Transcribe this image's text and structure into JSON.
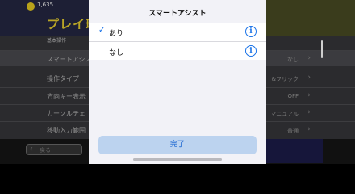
{
  "background": {
    "coins": "1,635",
    "title": "プレイ環",
    "section": "基本操作",
    "rows": [
      {
        "label": "スマートアシス",
        "value": "なし"
      },
      {
        "label": "操作タイプ",
        "value": "&フリック"
      },
      {
        "label": "方向キー表示",
        "value": "OFF"
      },
      {
        "label": "カーソルチェ",
        "value": "マニュアル"
      },
      {
        "label": "移動入力範囲",
        "value": "普通"
      }
    ],
    "back_label": "戻る"
  },
  "sheet": {
    "title": "スマートアシスト",
    "options": [
      {
        "label": "あり",
        "selected": true
      },
      {
        "label": "なし",
        "selected": false
      }
    ],
    "check_glyph": "✓",
    "info_glyph": "i",
    "done_label": "完了"
  },
  "colors": {
    "accent": "#1a73e8",
    "done_bg": "#bcd3ef",
    "sheet_bg": "#f2f2f7"
  }
}
